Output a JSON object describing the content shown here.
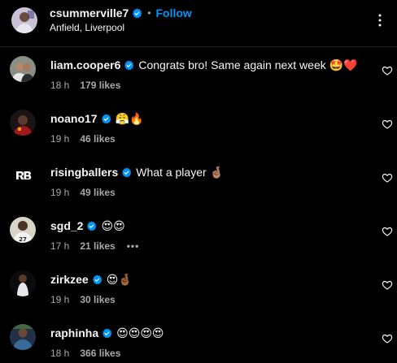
{
  "post_header": {
    "username": "csummerville7",
    "separator": "•",
    "follow_label": "Follow",
    "location": "Anfield, Liverpool"
  },
  "comments": [
    {
      "username": "liam.cooper6",
      "text": "Congrats bro! Same again next week 🤩❤️",
      "time": "18 h",
      "likes": "179 likes"
    },
    {
      "username": "noano17",
      "text": "😤🔥",
      "time": "19 h",
      "likes": "46 likes"
    },
    {
      "username": "risingballers",
      "text": "What a player 🤞🏽",
      "time": "19 h",
      "likes": "49 likes"
    },
    {
      "username": "sgd_2",
      "text": "😍😍",
      "time": "17 h",
      "likes": "21 likes"
    },
    {
      "username": "zirkzee",
      "text": "😍🤞🏾",
      "time": "19 h",
      "likes": "30 likes"
    },
    {
      "username": "raphinha",
      "text": "😍😍😍😍",
      "time": "18 h",
      "likes": "366 likes"
    }
  ],
  "colors": {
    "background": "#000000",
    "text": "#f5f5f5",
    "secondary_text": "#a8a8a8",
    "link": "#0095f6",
    "verified": "#0095f6"
  },
  "icons": {
    "verified": "verified-badge-icon",
    "more": "more-options-icon",
    "like": "heart-outline-icon"
  }
}
